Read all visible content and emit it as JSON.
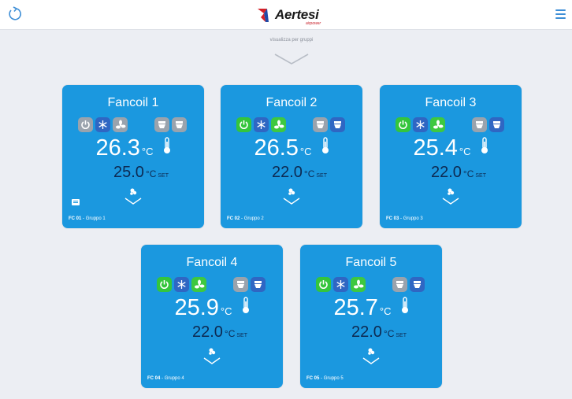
{
  "header": {
    "logo_text": "Aertesi",
    "logo_sub": "airpower"
  },
  "group_toggle_label": "visualizza per gruppi",
  "colors": {
    "card_bg": "#1b98df",
    "power_off": "#9aa3ad",
    "power_on": "#34c53c",
    "mode_icon": "#2f66c3",
    "setpoint_text": "#0d2a52"
  },
  "fancoils": [
    {
      "title": "Fancoil 1",
      "temp": "26.3",
      "temp_unit": "°C",
      "setpoint": "25.0",
      "setpoint_unit": "°C",
      "set_label": "SET",
      "code": "FC 01",
      "group": "Gruppo 1",
      "power": "off",
      "fan": "off"
    },
    {
      "title": "Fancoil 2",
      "temp": "26.5",
      "temp_unit": "°C",
      "setpoint": "22.0",
      "setpoint_unit": "°C",
      "set_label": "SET",
      "code": "FC 02",
      "group": "Gruppo 2",
      "power": "on",
      "fan": "max"
    },
    {
      "title": "Fancoil 3",
      "temp": "25.4",
      "temp_unit": "°C",
      "setpoint": "22.0",
      "setpoint_unit": "°C",
      "set_label": "SET",
      "code": "FC 03",
      "group": "Gruppo 3",
      "power": "on",
      "fan": "max"
    },
    {
      "title": "Fancoil 4",
      "temp": "25.9",
      "temp_unit": "°C",
      "setpoint": "22.0",
      "setpoint_unit": "°C",
      "set_label": "SET",
      "code": "FC 04",
      "group": "Gruppo 4",
      "power": "on",
      "fan": "max"
    },
    {
      "title": "Fancoil 5",
      "temp": "25.7",
      "temp_unit": "°C",
      "setpoint": "22.0",
      "setpoint_unit": "°C",
      "set_label": "SET",
      "code": "FC 05",
      "group": "Gruppo 5",
      "power": "on",
      "fan": "max"
    }
  ]
}
